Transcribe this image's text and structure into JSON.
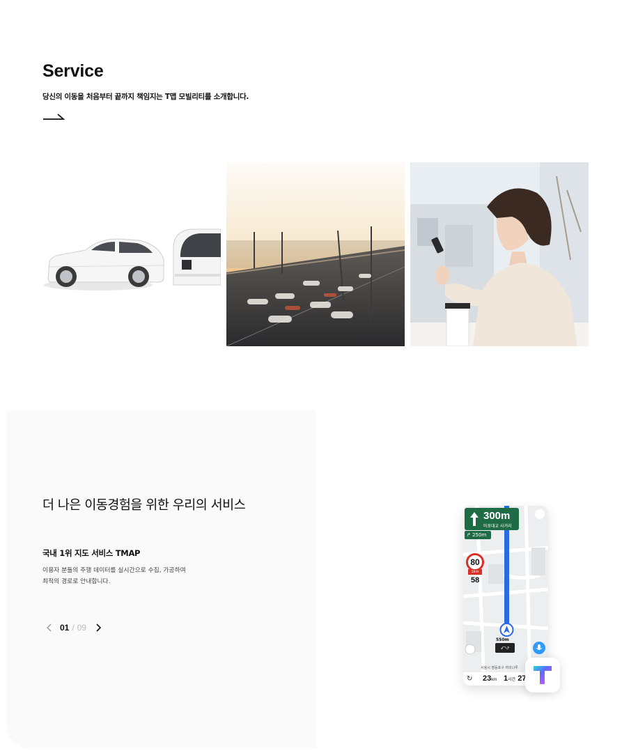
{
  "service": {
    "title": "Service",
    "subtitle": "당신의 이동을 처음부터 끝까지 책임지는 T맵 모빌리티를 소개합니다.",
    "arrow_icon": "arrow-right-icon",
    "images": [
      {
        "name": "cars-image",
        "description_icon": "car-and-bus"
      },
      {
        "name": "highway-image",
        "description_icon": "highway-traffic"
      },
      {
        "name": "woman-phone-image",
        "description_icon": "woman-using-phone"
      }
    ]
  },
  "services_panel": {
    "heading": "더 나은 이동경험을 위한 우리의 서비스",
    "item_title": "국내 1위 지도 서비스 TMAP",
    "item_desc_line1": "이용자 분들의 주행 데이터를 실시간으로 수집, 가공하여",
    "item_desc_line2": "최적의 경로로 안내합니다.",
    "pager": {
      "current": "01",
      "separator": "/",
      "total": "09",
      "prev_icon": "chevron-left-icon",
      "next_icon": "chevron-right-icon"
    }
  },
  "phone": {
    "nav_distance": "300m",
    "nav_street": "마포대교 사거리",
    "next_turn": "↱ 250m",
    "speed_limit": "80",
    "speed_zone": "1km",
    "current_speed": "58",
    "turn_distance": "550m",
    "location": "서울시 영등포구 여의나루",
    "remaining_distance": "23",
    "distance_unit": "km",
    "remaining_hours": "1",
    "hours_unit": "시간",
    "remaining_minutes": "27",
    "colors": {
      "nav_green": "#1f6b45",
      "route_blue": "#2b6be0",
      "speed_red": "#d93025"
    }
  },
  "logo": {
    "name": "tmap-logo",
    "colors": [
      "#2ad6d0",
      "#5b6cff",
      "#b45cff",
      "#ff4fa3"
    ]
  }
}
